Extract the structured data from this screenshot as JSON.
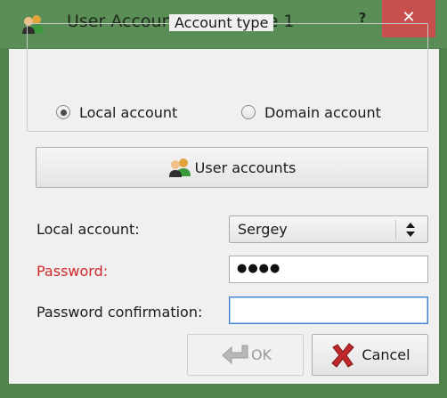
{
  "window": {
    "title": "User Account. Workplace 1",
    "help_label": "?",
    "close_label": "✕",
    "colors": {
      "frame": "#4f834b",
      "close": "#c7504f",
      "error_text": "#d0292b",
      "focus": "#3c7fd1"
    }
  },
  "account_type": {
    "title": "Account type",
    "options": [
      {
        "label": "Local account",
        "selected": true
      },
      {
        "label": "Domain account",
        "selected": false
      }
    ]
  },
  "user_accounts_button": {
    "label": "User accounts",
    "icon": "users-icon"
  },
  "fields": {
    "local_account": {
      "label": "Local account:",
      "value": "Sergey"
    },
    "password": {
      "label": "Password:",
      "value": "●●●●"
    },
    "password_confirmation": {
      "label": "Password confirmation:",
      "value": ""
    }
  },
  "buttons": {
    "ok": {
      "label": "OK",
      "enabled": false,
      "icon": "arrow-icon"
    },
    "cancel": {
      "label": "Cancel",
      "icon": "cross-icon"
    }
  }
}
